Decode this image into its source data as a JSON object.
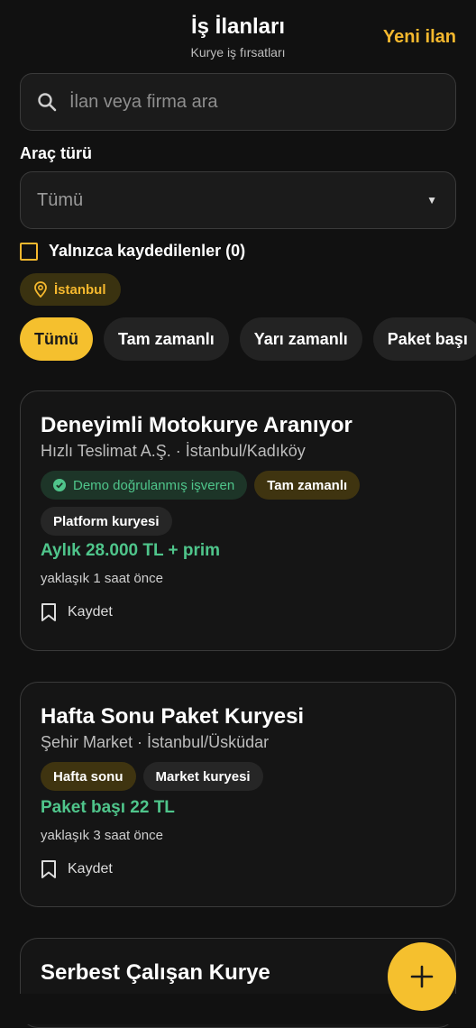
{
  "header": {
    "title": "İş İlanları",
    "subtitle": "Kurye iş fırsatları",
    "new_button": "Yeni ilan"
  },
  "search": {
    "placeholder": "İlan veya firma ara",
    "icon": "search-icon"
  },
  "vehicle_filter": {
    "label": "Araç türü",
    "selected": "Tümü",
    "icon": "dropdown-arrow-icon"
  },
  "saved_only": {
    "label": "Yalnızca kaydedilenler (0)",
    "checked": false
  },
  "location_chip": {
    "label": "İstanbul",
    "icon": "location-pin-icon"
  },
  "type_filters": [
    {
      "label": "Tümü",
      "active": true
    },
    {
      "label": "Tam zamanlı",
      "active": false
    },
    {
      "label": "Yarı zamanlı",
      "active": false
    },
    {
      "label": "Paket başı",
      "active": false
    }
  ],
  "jobs": [
    {
      "title": "Deneyimli Motokurye Aranıyor",
      "company": "Hızlı Teslimat A.Ş. · İstanbul/Kadıköy",
      "tags": [
        "Demo doğrulanmış işveren",
        "Tam zamanlı",
        "Platform kuryesi"
      ],
      "salary": "Aylık 28.000 TL + prim",
      "posted": "yaklaşık 1 saat önce",
      "save_label": "Kaydet"
    },
    {
      "title": "Hafta Sonu Paket Kuryesi",
      "company": "Şehir Market · İstanbul/Üsküdar",
      "tags": [
        "Hafta sonu",
        "Market kuryesi"
      ],
      "salary": "Paket başı 22 TL",
      "posted": "yaklaşık 3 saat önce",
      "save_label": "Kaydet"
    },
    {
      "title": "Serbest Çalışan Kurye"
    }
  ],
  "fab": {
    "icon": "plus-icon"
  },
  "colors": {
    "accent": "#f5c02e",
    "success": "#4fc58b",
    "background": "#111111"
  }
}
